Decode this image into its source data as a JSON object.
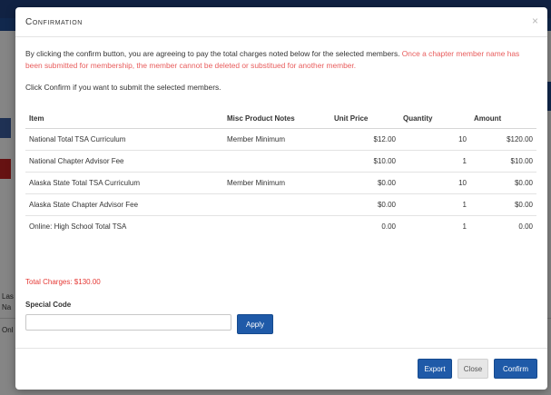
{
  "modal": {
    "title": "Confirmation",
    "close_glyph": "×",
    "intro_text": "By clicking the confirm button, you are agreeing to pay the total charges noted below for the selected members. ",
    "intro_warning": "Once a chapter member name has been submitted for membership, the member cannot be deleted or substitued for another member.",
    "instruction": "Click Confirm if you want to submit the selected members."
  },
  "table": {
    "headers": [
      "Item",
      "Misc Product Notes",
      "Unit Price",
      "Quantity",
      "Amount"
    ],
    "rows": [
      [
        "National Total TSA Curriculum",
        "Member Minimum",
        "$12.00",
        "10",
        "$120.00"
      ],
      [
        "National Chapter Advisor Fee",
        "",
        "$10.00",
        "1",
        "$10.00"
      ],
      [
        "Alaska State Total TSA Curriculum",
        "Member Minimum",
        "$0.00",
        "10",
        "$0.00"
      ],
      [
        "Alaska State Chapter Advisor Fee",
        "",
        "$0.00",
        "1",
        "$0.00"
      ],
      [
        "Online: High School Total TSA",
        "",
        "0.00",
        "1",
        "0.00"
      ]
    ]
  },
  "total_charges": "Total Charges: $130.00",
  "special_code": {
    "label": "Special Code",
    "value": "",
    "apply_label": "Apply"
  },
  "footer": {
    "export_label": "Export",
    "close_label": "Close",
    "confirm_label": "Confirm"
  },
  "background": {
    "col_label_1": "Las",
    "col_label_2": "Na",
    "row_text": "Onl"
  },
  "colors": {
    "primary": "#1f5aa8",
    "warning": "#e85c5c",
    "total": "#e53935"
  }
}
